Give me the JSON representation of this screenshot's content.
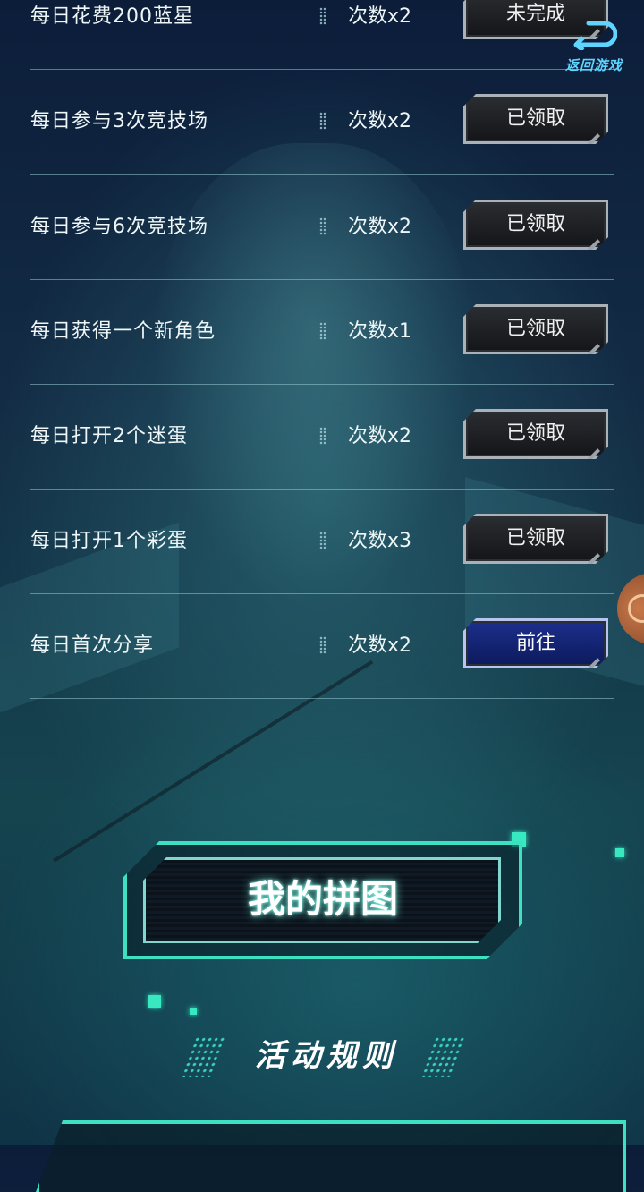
{
  "tasks": [
    {
      "name": "每日花费200蓝星",
      "count": "次数x2",
      "button": "未完成",
      "state": "incomplete"
    },
    {
      "name": "每日参与3次竞技场",
      "count": "次数x2",
      "button": "已领取",
      "state": "claimed"
    },
    {
      "name": "每日参与6次竞技场",
      "count": "次数x2",
      "button": "已领取",
      "state": "claimed"
    },
    {
      "name": "每日获得一个新角色",
      "count": "次数x1",
      "button": "已领取",
      "state": "claimed"
    },
    {
      "name": "每日打开2个迷蛋",
      "count": "次数x2",
      "button": "已领取",
      "state": "claimed"
    },
    {
      "name": "每日打开1个彩蛋",
      "count": "次数x3",
      "button": "已领取",
      "state": "claimed"
    },
    {
      "name": "每日首次分享",
      "count": "次数x2",
      "button": "前往",
      "state": "go"
    }
  ],
  "return_button": {
    "label": "返回游戏",
    "icon": "return-arrow-icon"
  },
  "puzzle_button": {
    "label": "我的拼图"
  },
  "rules": {
    "title": "活动规则"
  },
  "colors": {
    "accent": "#3ee0c2",
    "go_button": "#1c2f8c",
    "return_label": "#5fd4ff"
  }
}
